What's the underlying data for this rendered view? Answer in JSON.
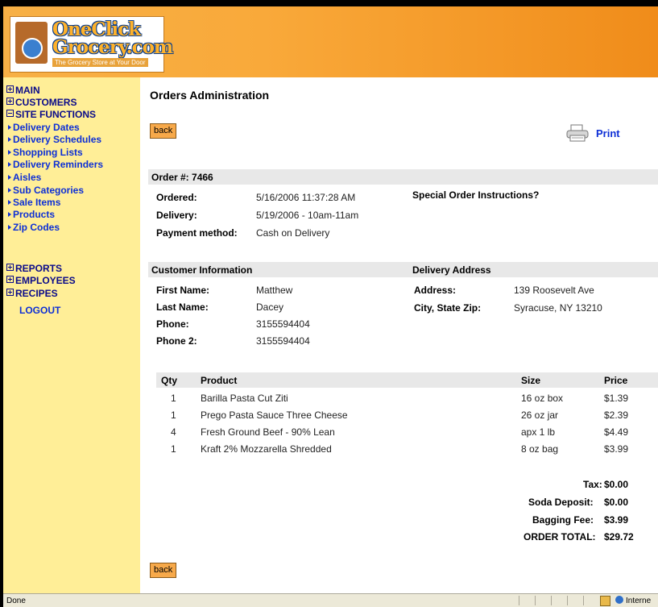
{
  "header": {
    "logo_line1": "OneClick",
    "logo_line2": "Grocery.com",
    "tagline": "The Grocery Store at Your Door"
  },
  "sidebar": {
    "main": "MAIN",
    "customers": "CUSTOMERS",
    "site_functions": "SITE FUNCTIONS",
    "site_items": [
      "Delivery Dates",
      "Delivery Schedules",
      "Shopping Lists",
      "Delivery Reminders",
      "Aisles",
      "Sub Categories",
      "Sale Items",
      "Products",
      "Zip Codes"
    ],
    "reports": "REPORTS",
    "employees": "EMPLOYEES",
    "recipes": "RECIPES",
    "logout": "LOGOUT"
  },
  "main": {
    "title": "Orders Administration",
    "back_label": "back",
    "print_label": "Print",
    "order_label": "Order #: 7466",
    "ordered_label": "Ordered:",
    "ordered_value": "5/16/2006 11:37:28 AM",
    "delivery_label": "Delivery:",
    "delivery_value": "5/19/2006 - 10am-11am",
    "payment_label": "Payment method:",
    "payment_value": "Cash on Delivery",
    "special_label": "Special Order Instructions?",
    "customer_header": "Customer Information",
    "delivery_address_header": "Delivery Address",
    "first_name_label": "First Name:",
    "first_name": "Matthew",
    "last_name_label": "Last Name:",
    "last_name": "Dacey",
    "phone_label": "Phone:",
    "phone": "3155594404",
    "phone2_label": "Phone 2:",
    "phone2": "3155594404",
    "address_label": "Address:",
    "address": "139 Roosevelt Ave",
    "city_label": "City, State Zip:",
    "city": "Syracuse, NY 13210",
    "items_headers": {
      "qty": "Qty",
      "product": "Product",
      "size": "Size",
      "price": "Price"
    },
    "items": [
      {
        "qty": "1",
        "product": "Barilla Pasta Cut Ziti",
        "size": "16 oz box",
        "price": "$1.39"
      },
      {
        "qty": "1",
        "product": "Prego Pasta Sauce Three Cheese",
        "size": "26 oz jar",
        "price": "$2.39"
      },
      {
        "qty": "4",
        "product": "Fresh Ground Beef - 90% Lean",
        "size": "apx 1 lb",
        "price": "$4.49"
      },
      {
        "qty": "1",
        "product": "Kraft 2% Mozzarella Shredded",
        "size": "8 oz bag",
        "price": "$3.99"
      }
    ],
    "totals": {
      "tax_label": "Tax:",
      "tax": "$0.00",
      "soda_label": "Soda Deposit:",
      "soda": "$0.00",
      "bagging_label": "Bagging Fee:",
      "bagging": "$3.99",
      "total_label": "ORDER TOTAL:",
      "total": "$29.72"
    }
  },
  "statusbar": {
    "text": "Done",
    "zone": "Interne"
  }
}
